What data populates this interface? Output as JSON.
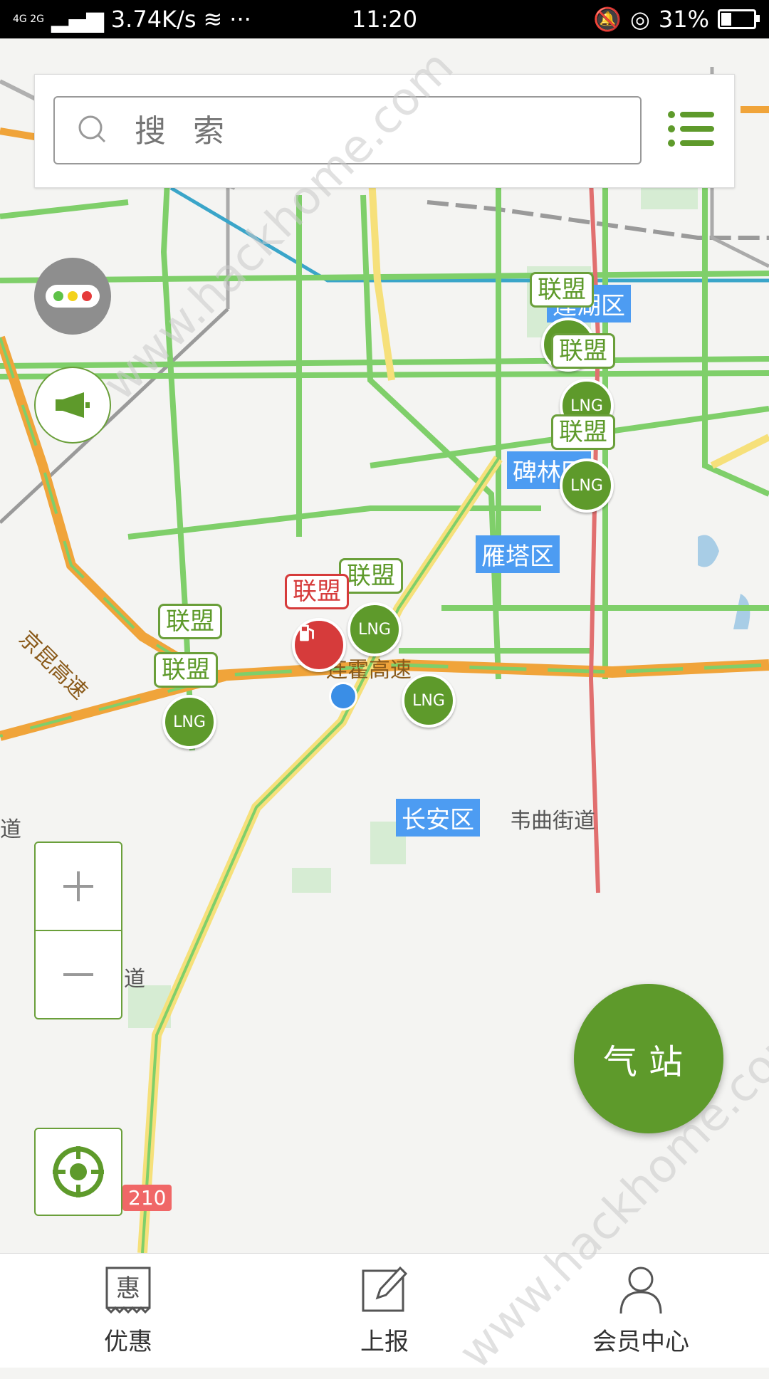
{
  "status_bar": {
    "network": "4G 2G",
    "speed": "3.74K/s",
    "time": "11:20",
    "battery": "31%",
    "battery_fraction": 0.31
  },
  "search": {
    "placeholder": "搜 索"
  },
  "map": {
    "areas": [
      {
        "text": "莲湖区"
      },
      {
        "text": "碑林区"
      },
      {
        "text": "雁塔区"
      },
      {
        "text": "长安区"
      }
    ],
    "roads": [
      {
        "text": "京昆高速"
      },
      {
        "text": "连霍高速"
      }
    ],
    "places": [
      {
        "text": "韦曲街道"
      },
      {
        "text": "道"
      },
      {
        "text": "道"
      }
    ],
    "shield": "210",
    "stations": [
      {
        "bubble": "联盟",
        "pin": "LNG"
      },
      {
        "bubble": "联盟",
        "pin": "LNG"
      },
      {
        "bubble": "联盟",
        "pin": "LNG"
      },
      {
        "bubble": "联盟",
        "pin": "LNG"
      },
      {
        "bubble": "联盟",
        "pin": "LNG"
      },
      {
        "bubble": "联盟",
        "pin": "LNG"
      }
    ],
    "selected_station": {
      "bubble": "联盟"
    }
  },
  "station_button": "气站",
  "bottom_nav": [
    {
      "label": "优惠",
      "icon": "discount-icon"
    },
    {
      "label": "上报",
      "icon": "report-icon"
    },
    {
      "label": "会员中心",
      "icon": "member-icon"
    }
  ],
  "watermark": "www.hackhome.com"
}
